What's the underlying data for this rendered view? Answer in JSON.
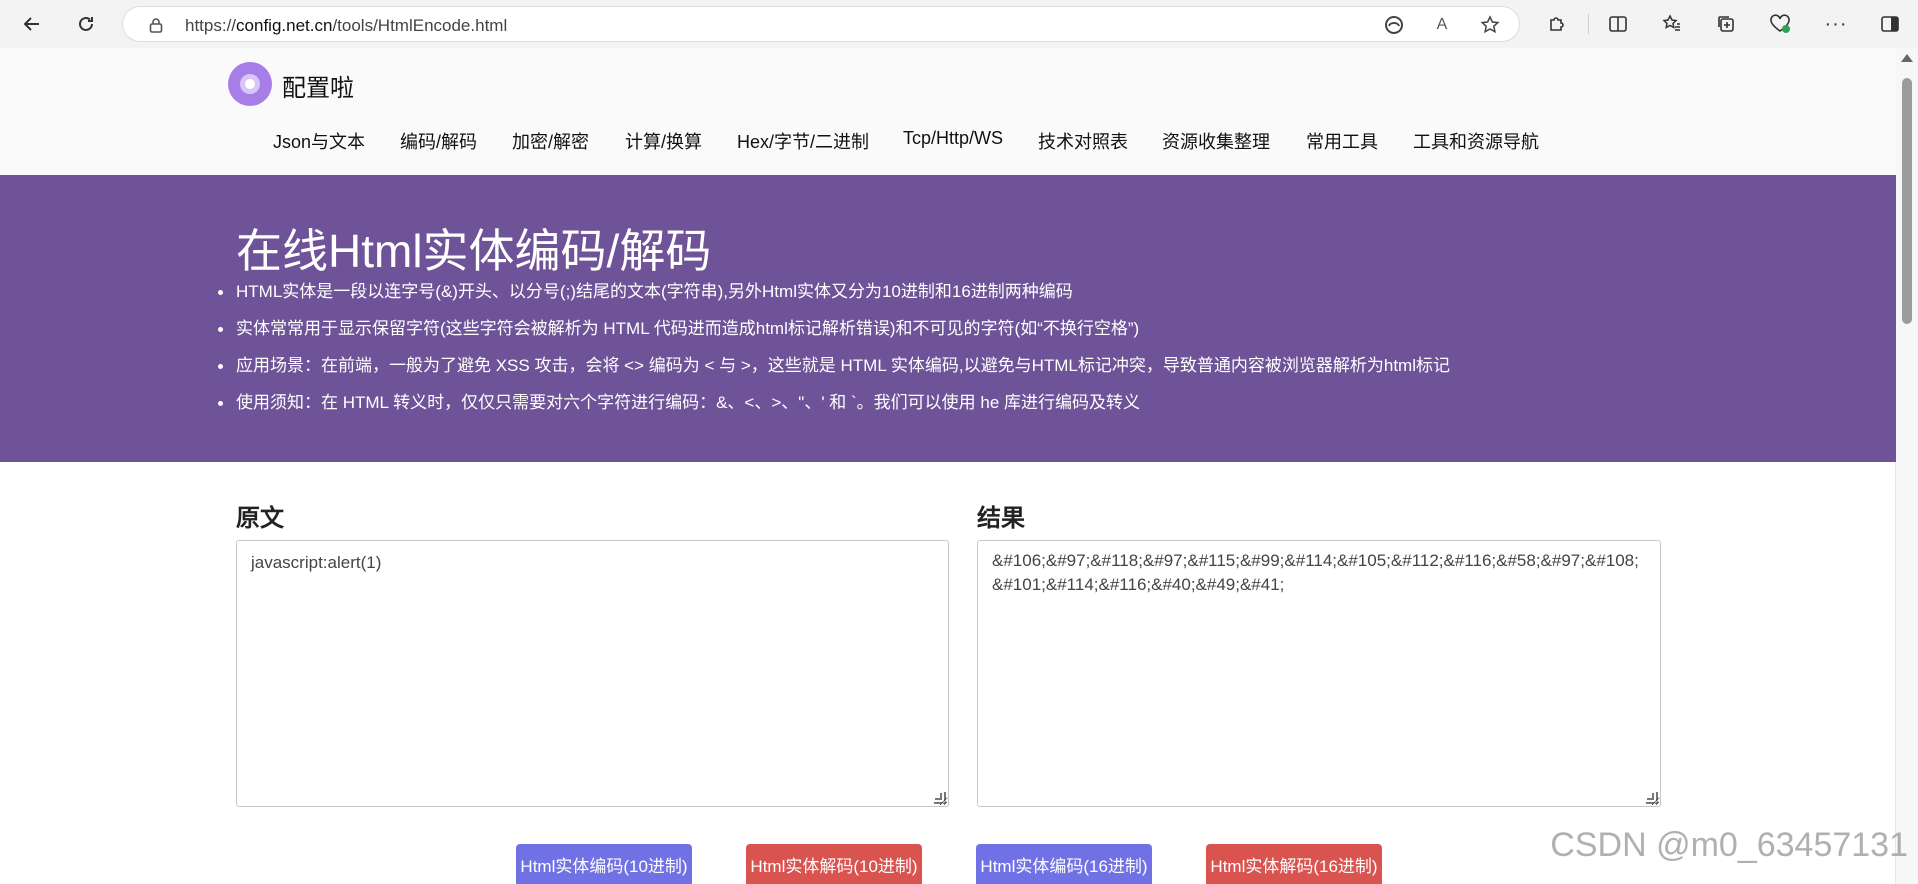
{
  "browser": {
    "url_prefix": "https://",
    "url_host": "config.net.cn",
    "url_path": "/tools/HtmlEncode.html"
  },
  "site": {
    "name": "配置啦",
    "nav": [
      "Json与文本",
      "编码/解码",
      "加密/解密",
      "计算/换算",
      "Hex/字节/二进制",
      "Tcp/Http/WS",
      "技术对照表",
      "资源收集整理",
      "常用工具",
      "工具和资源导航"
    ]
  },
  "banner": {
    "title": "在线Html实体编码/解码",
    "bullets": [
      "HTML实体是一段以连字号(&)开头、以分号(;)结尾的文本(字符串),另外Html实体又分为10进制和16进制两种编码",
      "实体常常用于显示保留字符(这些字符会被解析为 HTML 代码进而造成html标记解析错误)和不可见的字符(如“不换行空格”)",
      "应用场景：在前端，一般为了避免 XSS 攻击，会将 <> 编码为 < 与 >，这些就是 HTML 实体编码,以避免与HTML标记冲突，导致普通内容被浏览器解析为html标记",
      "使用须知：在 HTML 转义时，仅仅只需要对六个字符进行编码：&、<、>、\"、' 和 `。我们可以使用 he 库进行编码及转义"
    ],
    "bg_color": "#6e5398"
  },
  "tool": {
    "source_label": "原文",
    "source_value": "javascript:alert(1)",
    "result_label": "结果",
    "result_value": "&#106;&#97;&#118;&#97;&#115;&#99;&#114;&#105;&#112;&#116;&#58;&#97;&#108;&#101;&#114;&#116;&#40;&#49;&#41;",
    "buttons": [
      "Html实体编码(10进制)",
      "Html实体解码(10进制)",
      "Html实体编码(16进制)",
      "Html实体解码(16进制)"
    ],
    "encode_color": "#7171e6",
    "decode_color": "#d9534f"
  },
  "watermark": "CSDN @m0_63457131"
}
